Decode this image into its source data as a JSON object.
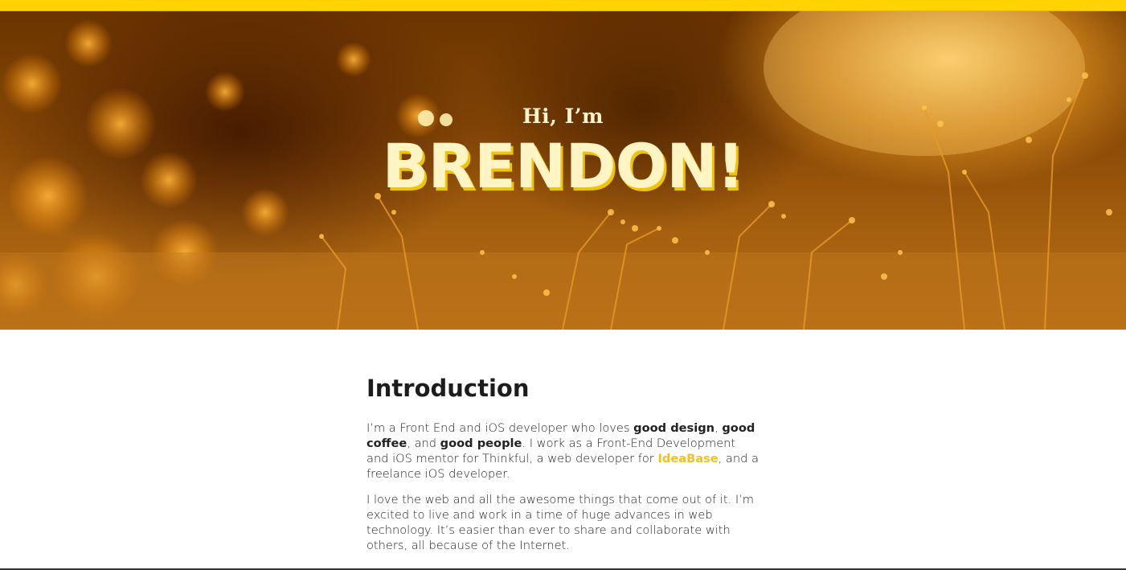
{
  "hero": {
    "greeting": "Hi, I’m",
    "name": "BRENDON!"
  },
  "intro": {
    "heading": "Introduction",
    "p1": {
      "t1": "I’m a Front End and iOS developer who loves ",
      "b1": "good design",
      "t2": ", ",
      "b2": "good coffee",
      "t3": ", and ",
      "b3": "good people",
      "t4": ". I work as a Front-End Development and iOS mentor for Thinkful, a web developer for ",
      "link": "IdeaBase",
      "t5": ", and a freelance iOS developer."
    },
    "p2": "I love the web and all the awesome things that come out of it. I’m excited to live and work in a time of huge advances in web technology. It’s easier than ever to share and collaborate with others, all because of the Internet."
  },
  "colors": {
    "accent": "#ffd200",
    "link": "#f2c022",
    "name_text": "#fff5c4"
  }
}
